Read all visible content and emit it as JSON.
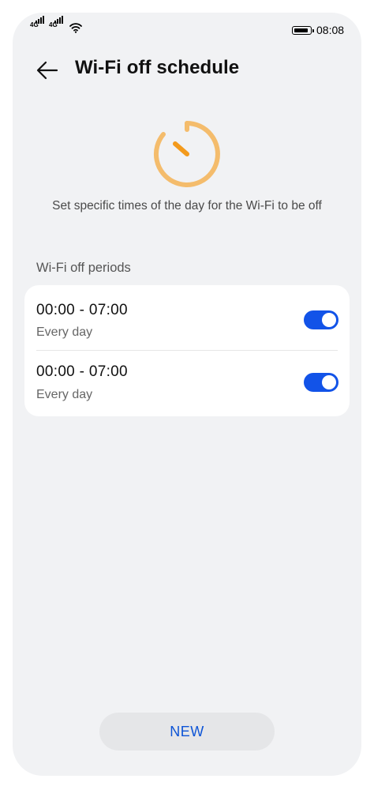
{
  "status_bar": {
    "signal_1_label": "4G",
    "signal_2_label": "4G",
    "time": "08:08"
  },
  "header": {
    "title": "Wi-Fi off schedule"
  },
  "hero": {
    "description": "Set specific times of the day for the Wi-Fi to be off"
  },
  "section": {
    "title": "Wi-Fi off periods"
  },
  "periods": [
    {
      "time": "00:00 - 07:00",
      "repeat": "Every day",
      "enabled": true
    },
    {
      "time": "00:00 - 07:00",
      "repeat": "Every day",
      "enabled": true
    }
  ],
  "footer": {
    "new_label": "NEW"
  },
  "colors": {
    "accent": "#1253e8",
    "timer": "#f4bc6c",
    "timer_hand": "#f39a1c",
    "background": "#f1f2f4"
  }
}
